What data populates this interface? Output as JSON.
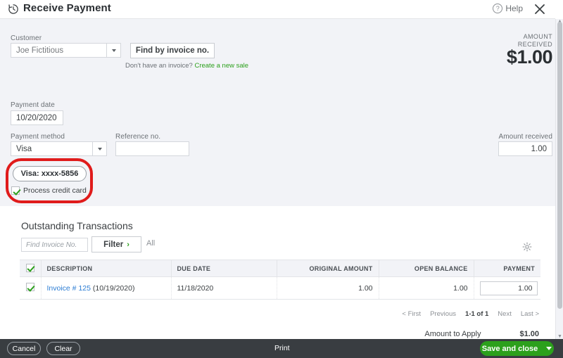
{
  "header": {
    "title": "Receive Payment",
    "history_icon": "history-clock-icon",
    "help_label": "Help",
    "help_icon": "question-mark-icon",
    "close_icon": "close-x-icon"
  },
  "form": {
    "customer_label": "Customer",
    "customer_value": "Joe Fictitious",
    "find_by_invoice_label": "Find by invoice no.",
    "no_invoice_text": "Don't have an invoice?",
    "create_sale_link": "Create a new sale",
    "amount_received_caption_line1": "AMOUNT",
    "amount_received_caption_line2": "RECEIVED",
    "amount_received_big": "$1.00",
    "payment_date_label": "Payment date",
    "payment_date_value": "10/20/2020",
    "payment_method_label": "Payment method",
    "payment_method_value": "Visa",
    "reference_label": "Reference no.",
    "reference_value": "",
    "amount_received_field_label": "Amount received",
    "amount_received_field_value": "1.00",
    "card_pill_label": "Visa: xxxx-5856",
    "process_credit_card_label": "Process credit card"
  },
  "outstanding": {
    "title": "Outstanding Transactions",
    "find_invoice_placeholder": "Find Invoice No.",
    "filter_label": "Filter",
    "filter_chevron": "›",
    "all_label": "All",
    "gear_icon": "gear-settings-icon",
    "columns": [
      "DESCRIPTION",
      "DUE DATE",
      "ORIGINAL AMOUNT",
      "OPEN BALANCE",
      "PAYMENT"
    ],
    "rows": [
      {
        "checked": true,
        "invoice_link": "Invoice # 125",
        "invoice_date": "(10/19/2020)",
        "due_date": "11/18/2020",
        "original_amount": "1.00",
        "open_balance": "1.00",
        "payment": "1.00"
      }
    ],
    "pagination": {
      "first": "< First",
      "previous": "Previous",
      "range": "1-1 of 1",
      "next": "Next",
      "last": "Last >"
    },
    "amount_to_apply_label": "Amount to Apply",
    "amount_to_apply_value": "$1.00"
  },
  "toolbar": {
    "cancel_label": "Cancel",
    "clear_label": "Clear",
    "print_label": "Print",
    "save_and_close_label": "Save and close"
  },
  "colors": {
    "brand_green": "#2ca01c",
    "annotation_red": "#e01b1b",
    "link_blue": "#2b7cd3",
    "panel_gray": "#f2f3f7",
    "toolbar_dark": "#393d41"
  }
}
